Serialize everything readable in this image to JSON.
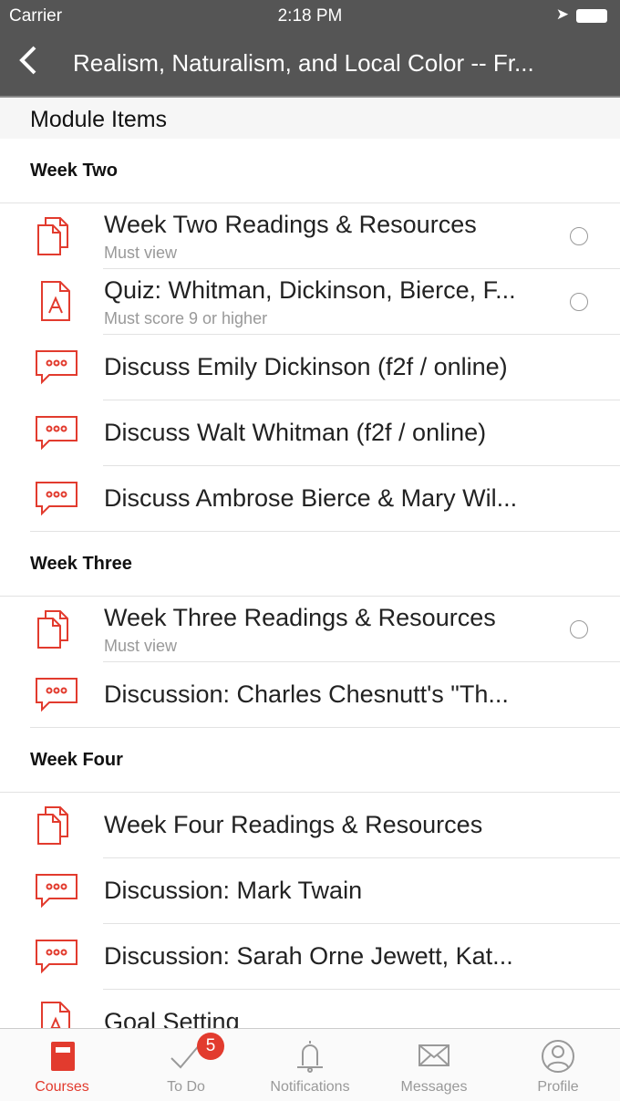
{
  "status": {
    "carrier": "Carrier",
    "time": "2:18 PM"
  },
  "nav": {
    "title": "Realism, Naturalism, and Local Color -- Fr..."
  },
  "module_header": "Module Items",
  "accent": "#e23b2e",
  "sections": [
    {
      "title": "Week Two",
      "items": [
        {
          "type": "page",
          "title": "Week Two Readings & Resources",
          "subtitle": "Must view",
          "check": true
        },
        {
          "type": "quiz",
          "title": "Quiz: Whitman, Dickinson, Bierce, F...",
          "subtitle": "Must score 9 or higher",
          "check": true
        },
        {
          "type": "discussion",
          "title": "Discuss Emily Dickinson (f2f / online)"
        },
        {
          "type": "discussion",
          "title": "Discuss Walt Whitman (f2f / online)"
        },
        {
          "type": "discussion",
          "title": "Discuss Ambrose Bierce & Mary Wil..."
        }
      ]
    },
    {
      "title": "Week Three",
      "items": [
        {
          "type": "page",
          "title": "Week Three Readings & Resources",
          "subtitle": "Must view",
          "check": true
        },
        {
          "type": "discussion",
          "title": "Discussion: Charles Chesnutt's \"Th..."
        }
      ]
    },
    {
      "title": "Week Four",
      "items": [
        {
          "type": "page",
          "title": "Week Four Readings & Resources"
        },
        {
          "type": "discussion",
          "title": "Discussion: Mark Twain"
        },
        {
          "type": "discussion",
          "title": "Discussion: Sarah Orne Jewett, Kat..."
        },
        {
          "type": "quiz",
          "title": "Goal Setting"
        }
      ]
    }
  ],
  "tabs": [
    {
      "label": "Courses",
      "icon": "book-icon",
      "active": true
    },
    {
      "label": "To Do",
      "icon": "checkmark-icon",
      "badge": "5"
    },
    {
      "label": "Notifications",
      "icon": "bell-icon"
    },
    {
      "label": "Messages",
      "icon": "envelope-icon"
    },
    {
      "label": "Profile",
      "icon": "person-icon"
    }
  ]
}
